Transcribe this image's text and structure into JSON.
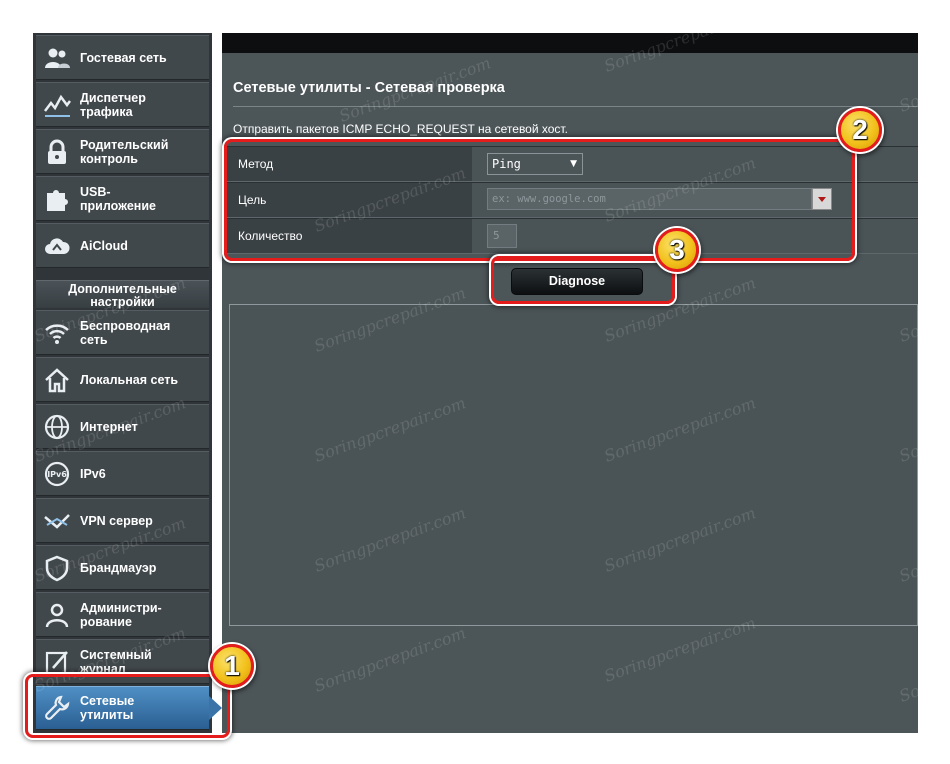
{
  "sidebar": {
    "top_items": [
      {
        "label": "Гостевая сеть",
        "icon": "guest-network-icon"
      },
      {
        "label": "Диспетчер\nтрафика",
        "icon": "traffic-manager-icon"
      },
      {
        "label": "Родительский\nконтроль",
        "icon": "lock-icon"
      },
      {
        "label": "USB-\nприложение",
        "icon": "puzzle-icon"
      },
      {
        "label": "AiCloud",
        "icon": "cloud-icon"
      }
    ],
    "section_header": "Дополнительные\nнастройки",
    "advanced_items": [
      {
        "label": "Беспроводная\nсеть",
        "icon": "wifi-icon"
      },
      {
        "label": "Локальная сеть",
        "icon": "home-icon"
      },
      {
        "label": "Интернет",
        "icon": "globe-icon"
      },
      {
        "label": "IPv6",
        "icon": "ipv6-icon"
      },
      {
        "label": "VPN сервер",
        "icon": "vpn-icon"
      },
      {
        "label": "Брандмауэр",
        "icon": "firewall-icon"
      },
      {
        "label": "Администри-\nрование",
        "icon": "admin-icon"
      },
      {
        "label": "Системный\nжурнал",
        "icon": "system-log-icon"
      },
      {
        "label": "Сетевые\nутилиты",
        "icon": "wrench-icon",
        "active": true
      }
    ]
  },
  "main": {
    "title": "Сетевые утилиты - Сетевая проверка",
    "description": "Отправить пакетов ICMP ECHO_REQUEST на сетевой хост.",
    "form": {
      "method_label": "Метод",
      "method_value": "Ping",
      "target_label": "Цель",
      "target_placeholder": "ex: www.google.com",
      "count_label": "Количество",
      "count_value": "5"
    },
    "diagnose_label": "Diagnose",
    "output": ""
  },
  "annotations": {
    "badge_1": "1",
    "badge_2": "2",
    "badge_3": "3"
  },
  "watermark": "Soringpcrepair.com",
  "colors": {
    "annotation_red": "#e41c1c",
    "badge_yellow": "#f2c11c",
    "active_blue": "#3a73a8"
  }
}
